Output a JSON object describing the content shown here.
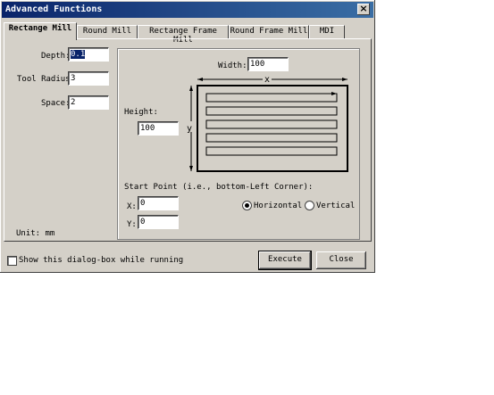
{
  "dialog": {
    "title": "Advanced Functions",
    "close_glyph": "×"
  },
  "tabs": [
    {
      "label": "Rectange Mill",
      "active": true
    },
    {
      "label": "Round Mill"
    },
    {
      "label": "Rectange Frame Mill"
    },
    {
      "label": "Round Frame Mill"
    },
    {
      "label": "MDI"
    }
  ],
  "left": {
    "depth_label": "Depth:",
    "depth_value": "0.1",
    "tool_radius_label": "Tool Radius:",
    "tool_radius_value": "3",
    "space_label": "Space:",
    "space_value": "2",
    "unit_label": "Unit: mm"
  },
  "group": {
    "width_label": "Width:",
    "width_value": "100",
    "height_label": "Height:",
    "height_value": "100",
    "axis_x": "x",
    "axis_y": "y",
    "start_point_label": "Start Point (i.e., bottom-Left Corner):",
    "x_label": "X:",
    "x_value": "0",
    "y_label": "Y:",
    "y_value": "0",
    "horizontal_label": "Horizontal",
    "vertical_label": "Vertical",
    "direction_selected": "Horizontal"
  },
  "footer": {
    "show_dialog_label": "Show this dialog-box while running",
    "execute_label": "Execute",
    "close_label": "Close"
  }
}
